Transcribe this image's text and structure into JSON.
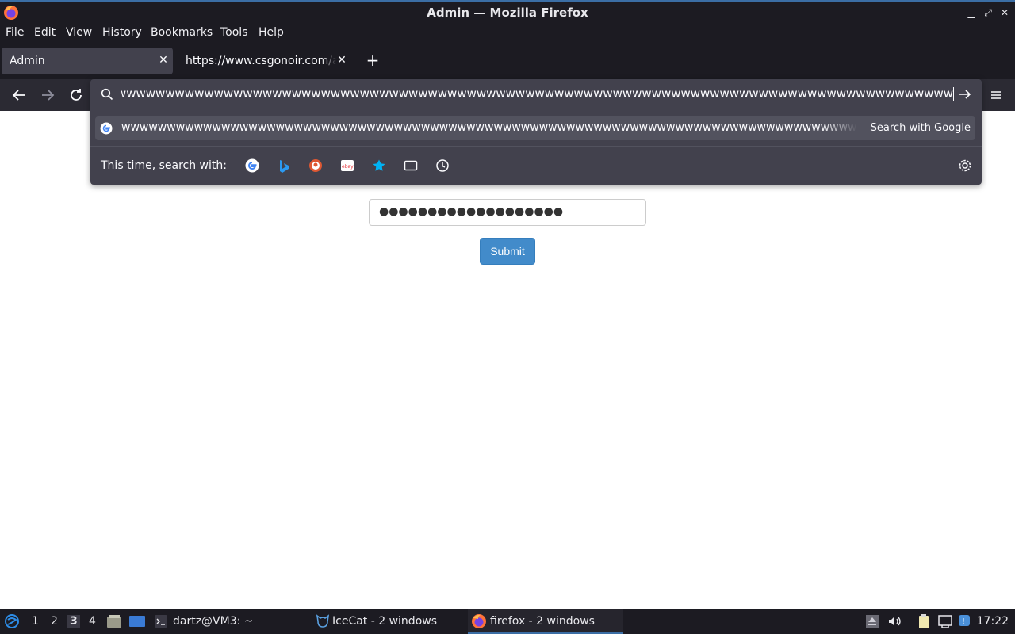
{
  "window": {
    "title": "Admin — Mozilla Firefox"
  },
  "menu": {
    "items": [
      "File",
      "Edit",
      "View",
      "History",
      "Bookmarks",
      "Tools",
      "Help"
    ]
  },
  "tabs": [
    {
      "label": "Admin",
      "active": true
    },
    {
      "label": "https://www.csgonoir.com/ac",
      "active": false
    }
  ],
  "urlbar": {
    "value": "wwwwwwwwwwwwwwwwwwwwwwwwwwwwwwwwwwwwwwwwwwwwwwwwwwwwwwwwwwwwwwwwwwwwwwwwwwwwwwwwwwwwwwwwwwwwwwwwwwwwwwww",
    "suggestion_text": "wwwwwwwwwwwwwwwwwwwwwwwwwwwwwwwwwwwwwwwwwwwwwwwwwwwwwwwwwwwwwwwwwwwwwwwwwwwwwwwwwwwwwwwwwwwwwwwwwwwwwwwww",
    "suggestion_action": "— Search with Google",
    "oneoff_label": "This time, search with:",
    "engines": [
      "google-icon",
      "bing-icon",
      "duckduckgo-icon",
      "ebay-icon",
      "bookmarks-star-icon",
      "tabs-icon",
      "history-icon"
    ]
  },
  "page": {
    "password_dots": "●●●●●●●●●●●●●●●●●●●",
    "submit_label": "Submit"
  },
  "taskbar": {
    "workspaces": [
      "1",
      "2",
      "3",
      "4"
    ],
    "active_workspace": "3",
    "tasks": [
      {
        "label": "dartz@VM3: ~",
        "icon": "terminal-icon"
      },
      {
        "label": "IceCat - 2 windows",
        "icon": "icecat-icon"
      },
      {
        "label": "firefox - 2 windows",
        "icon": "firefox-icon",
        "active": true
      }
    ],
    "clock": "17:22"
  },
  "colors": {
    "chrome_dark": "#1c1b22",
    "navbar": "#2b2a33",
    "panel": "#42414d",
    "accent_blue": "#428bca"
  }
}
